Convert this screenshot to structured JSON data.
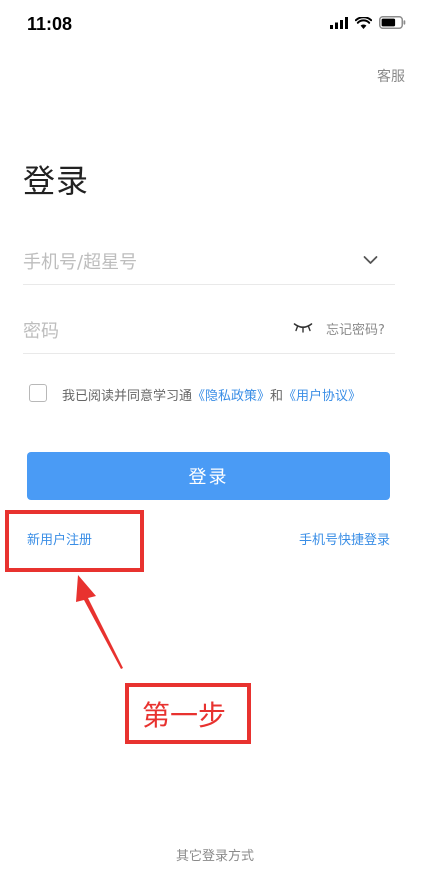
{
  "status_bar": {
    "time": "11:08"
  },
  "header": {
    "support_label": "客服"
  },
  "title": "登录",
  "phone_field": {
    "placeholder": "手机号/超星号"
  },
  "password_field": {
    "placeholder": "密码",
    "forgot_label": "忘记密码?"
  },
  "consent": {
    "prefix": "我已阅读并同意学习通",
    "privacy_label": "《隐私政策》",
    "conjunction": "和",
    "agreement_label": "《用户协议》"
  },
  "login_button_label": "登录",
  "links": {
    "register_label": "新用户注册",
    "quick_login_label": "手机号快捷登录"
  },
  "annotation": {
    "step_label": "第一步",
    "color": "#e8322f"
  },
  "footer": {
    "other_login_label": "其它登录方式"
  },
  "colors": {
    "accent": "#4a9bf5",
    "link": "#3a8ee6"
  }
}
